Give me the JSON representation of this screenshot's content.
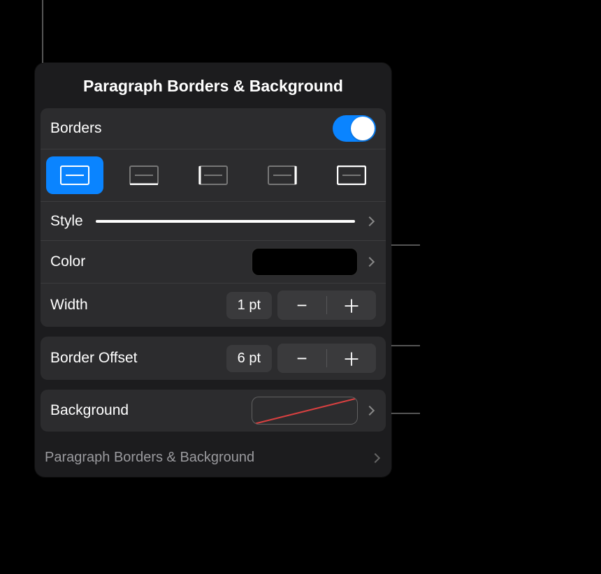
{
  "panel": {
    "title": "Paragraph Borders & Background"
  },
  "borders": {
    "label": "Borders",
    "toggle_on": true,
    "positions": [
      "all",
      "bottom",
      "left",
      "right",
      "outer"
    ]
  },
  "style": {
    "label": "Style"
  },
  "color": {
    "label": "Color",
    "value_hex": "#000000"
  },
  "width": {
    "label": "Width",
    "value": "1 pt"
  },
  "offset": {
    "label": "Border Offset",
    "value": "6 pt"
  },
  "background": {
    "label": "Background",
    "value": "none"
  },
  "nav": {
    "label": "Paragraph Borders & Background"
  }
}
